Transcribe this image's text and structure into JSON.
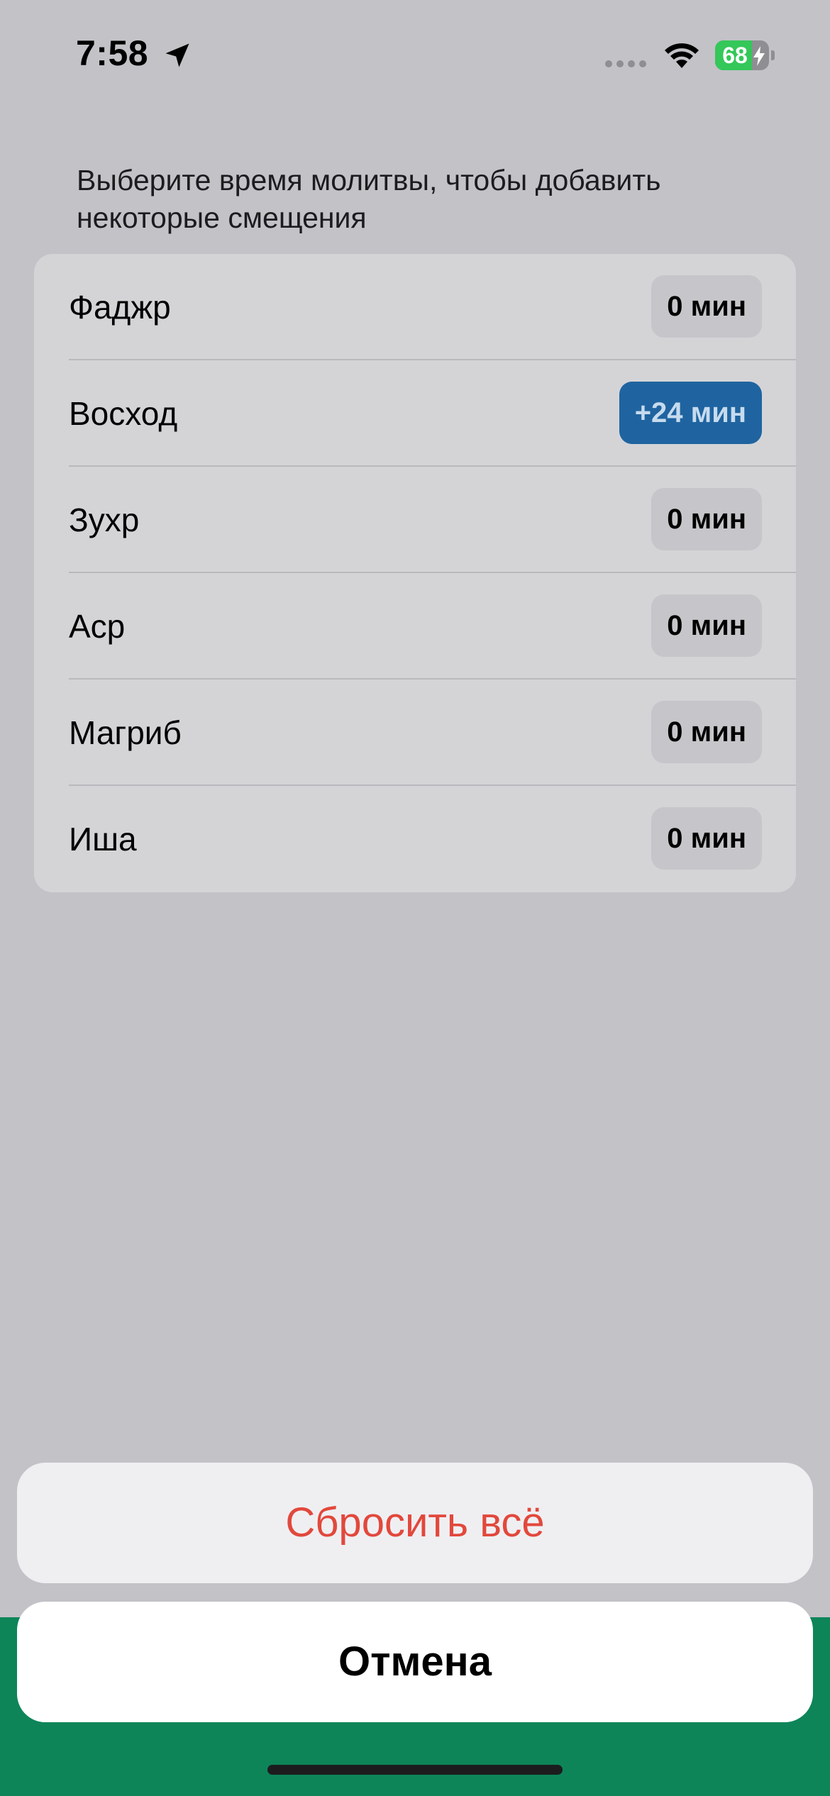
{
  "status_bar": {
    "time": "7:58",
    "battery_level": "68",
    "battery_fraction": 0.68,
    "location_icon": "location-arrow-icon",
    "wifi_icon": "wifi-icon",
    "bolt_icon": "charging-bolt-icon"
  },
  "instruction": "Выберите время молитвы, чтобы добавить некоторые смещения",
  "prayers": [
    {
      "name": "Фаджр",
      "offset": "0 мин",
      "active": false
    },
    {
      "name": "Восход",
      "offset": "+24 мин",
      "active": true
    },
    {
      "name": "Зухр",
      "offset": "0 мин",
      "active": false
    },
    {
      "name": "Аср",
      "offset": "0 мин",
      "active": false
    },
    {
      "name": "Магриб",
      "offset": "0 мин",
      "active": false
    },
    {
      "name": "Иша",
      "offset": "0 мин",
      "active": false
    }
  ],
  "action_sheet": {
    "reset_label": "Сбросить всё",
    "cancel_label": "Отмена"
  },
  "colors": {
    "accent_active": "#1f64a0",
    "destructive": "#e2483c",
    "brand_green": "#0d8559",
    "battery_green": "#34c759"
  }
}
